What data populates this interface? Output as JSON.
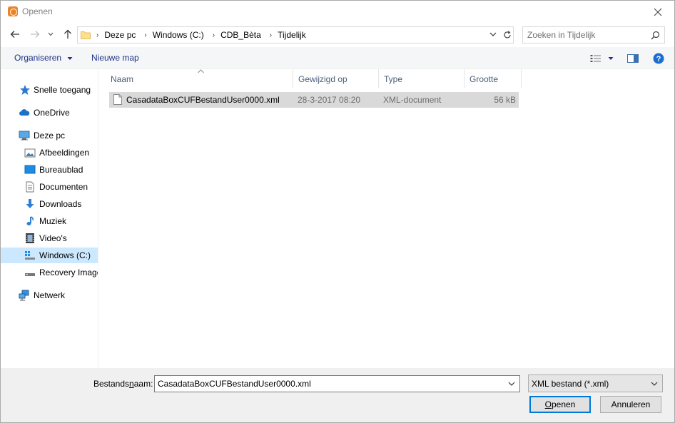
{
  "window": {
    "title": "Openen",
    "close_icon": "close-icon"
  },
  "address": {
    "breadcrumbs": [
      "Deze pc",
      "Windows (C:)",
      "CDB_Bèta",
      "Tijdelijk"
    ]
  },
  "search": {
    "placeholder": "Zoeken in Tijdelijk"
  },
  "toolbar": {
    "organize_label": "Organiseren",
    "new_folder_label": "Nieuwe map"
  },
  "nav": {
    "items": [
      {
        "label": "Snelle toegang",
        "icon": "star-icon"
      },
      {
        "label": "OneDrive",
        "icon": "cloud-icon"
      },
      {
        "label": "Deze pc",
        "icon": "computer-icon"
      },
      {
        "label": "Afbeeldingen",
        "icon": "pictures-icon"
      },
      {
        "label": "Bureaublad",
        "icon": "desktop-icon"
      },
      {
        "label": "Documenten",
        "icon": "documents-icon"
      },
      {
        "label": "Downloads",
        "icon": "download-icon"
      },
      {
        "label": "Muziek",
        "icon": "music-icon"
      },
      {
        "label": "Video's",
        "icon": "video-icon"
      },
      {
        "label": "Windows (C:)",
        "icon": "drive-icon"
      },
      {
        "label": "Recovery Image",
        "icon": "drive-icon"
      },
      {
        "label": "Netwerk",
        "icon": "network-icon"
      }
    ]
  },
  "columns": {
    "name": "Naam",
    "modified": "Gewijzigd op",
    "type": "Type",
    "size": "Grootte"
  },
  "files": [
    {
      "name": "CasadataBoxCUFBestandUser0000.xml",
      "modified": "28-3-2017 08:20",
      "type": "XML-document",
      "size": "56 kB"
    }
  ],
  "bottom": {
    "filename_label_pre": "Bestands",
    "filename_label_underlined": "n",
    "filename_label_post": "aam:",
    "filename_value": "CasadataBoxCUFBestandUser0000.xml",
    "filetype_value": "XML bestand (*.xml)",
    "open_label_underlined": "O",
    "open_label_rest": "penen",
    "cancel_label": "Annuleren"
  },
  "colors": {
    "accent": "#0078d7",
    "selected_nav": "#cce8ff",
    "toolbar_text": "#1e3287",
    "help": "#1c6dd0"
  }
}
